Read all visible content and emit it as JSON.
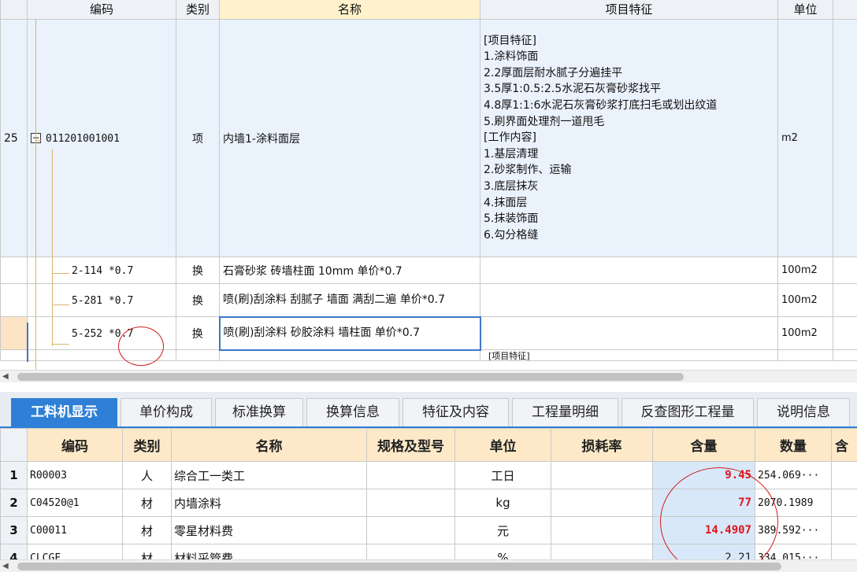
{
  "top_table": {
    "headers": [
      "编码",
      "类别",
      "名称",
      "项目特征",
      "单位"
    ],
    "rows": [
      {
        "index": "25",
        "code": "011201001001",
        "type": "项",
        "name": "内墙1-涂料面层",
        "features": "[项目特征]\n1.涂料饰面\n2.2厚面层耐水腻子分遍挂平\n3.5厚1:0.5:2.5水泥石灰膏砂浆找平\n4.8厚1:1:6水泥石灰膏砂浆打底扫毛或划出纹道\n5.刷界面处理剂一道甩毛\n[工作内容]\n1.基层清理\n2.砂浆制作、运输\n3.底层抹灰\n4.抹面层\n5.抹装饰面\n6.勾分格缝",
        "unit": "m2"
      },
      {
        "code": "2-114 *0.7",
        "type": "换",
        "name": "石膏砂浆 砖墙柱面 10mm  单价*0.7",
        "unit": "100m2"
      },
      {
        "code": "5-281 *0.7",
        "type": "换",
        "name": "喷(刷)刮涂料 刮腻子 墙面 满刮二遍 单价*0.7",
        "unit": "100m2"
      },
      {
        "code": "5-252 *0.7",
        "type": "换",
        "name": "喷(刷)刮涂料 砂胶涂料 墙柱面  单价*0.7",
        "unit": "100m2"
      }
    ],
    "partial_feature_text": "[项目特征]"
  },
  "tabs": [
    "工料机显示",
    "单价构成",
    "标准换算",
    "换算信息",
    "特征及内容",
    "工程量明细",
    "反查图形工程量",
    "说明信息"
  ],
  "active_tab": 0,
  "bottom_table": {
    "headers": [
      "编码",
      "类别",
      "名称",
      "规格及型号",
      "单位",
      "损耗率",
      "含量",
      "数量",
      "含"
    ],
    "rows": [
      {
        "index": "1",
        "code": "R00003",
        "type": "人",
        "name": "综合工一类工",
        "spec": "",
        "unit": "工日",
        "loss": "",
        "content": "9.45",
        "quantity": "254.069···"
      },
      {
        "index": "2",
        "code": "C04520@1",
        "type": "材",
        "name": "内墙涂料",
        "spec": "",
        "unit": "kg",
        "loss": "",
        "content": "77",
        "quantity": "2070.1989"
      },
      {
        "index": "3",
        "code": "C00011",
        "type": "材",
        "name": "零星材料费",
        "spec": "",
        "unit": "元",
        "loss": "",
        "content": "14.4907",
        "quantity": "389.592···"
      },
      {
        "index": "4",
        "code": "CLCGF",
        "type": "材",
        "name": "材料采管费",
        "spec": "",
        "unit": "%",
        "loss": "",
        "content": "2.21",
        "quantity": "334.015···"
      }
    ]
  },
  "colors": {
    "accent": "#2f7fd6",
    "highlight_red": "#e0141e",
    "annotation_circle": "#d11b1b"
  }
}
